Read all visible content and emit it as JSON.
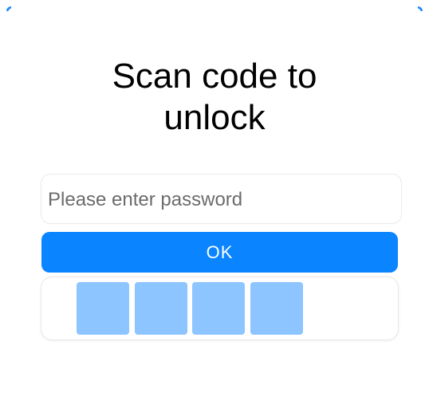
{
  "dialog": {
    "title_line1": "Scan code to",
    "title_line2": "unlock",
    "password": {
      "placeholder": "Please enter password",
      "value": ""
    },
    "ok_label": "OK",
    "code_cells_count": 4
  },
  "colors": {
    "accent": "#0a84ff",
    "code_cell": "#8cc5ff",
    "corner_accent": "#1e88ff"
  }
}
